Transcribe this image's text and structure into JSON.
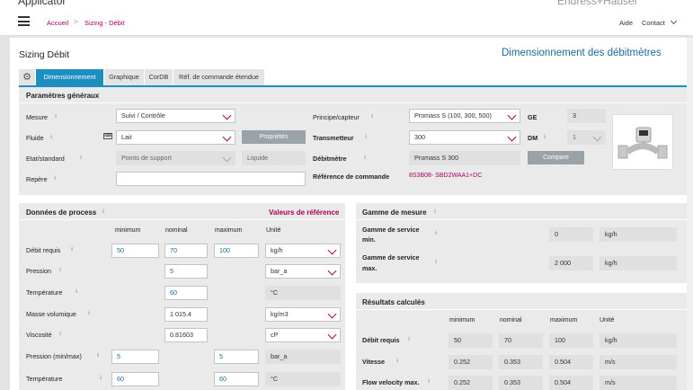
{
  "header": {
    "app_title_peek": "Applicator",
    "right_peek": "Endress+Hauser",
    "breadcrumb": {
      "home": "Accueil",
      "sep": ">",
      "current": "Sizing - Débit"
    },
    "nav": {
      "help": "Aide",
      "contact": "Contact"
    }
  },
  "page": {
    "title": "Sizing Débit",
    "subtitle": "Dimensionnement des débitmètres"
  },
  "tabs": [
    "Dimensionnement",
    "Graphique",
    "CorDB",
    "Réf. de commande étendue"
  ],
  "general": {
    "heading": "Paramètres généraux",
    "mesure_label": "Mesure",
    "mesure_value": "Suivi / Contrôle",
    "fluide_label": "Fluide",
    "fluide_value": "Lait",
    "proprietes": "Propriétés",
    "etat_label": "Etat/standard",
    "etat_value": "Points de support",
    "etat_state": "Liquide",
    "repere_label": "Repère",
    "repere_value": "",
    "principe_label": "Principe/capteur",
    "principe_value": "Promass S (100, 300, 500)",
    "ge_label": "GE",
    "ge_value": "3",
    "transmetteur_label": "Transmetteur",
    "transmetteur_value": "300",
    "dm_label": "DM",
    "dm_value": "1",
    "debitmetre_label": "Débitmètre",
    "debitmetre_value": "Promass S 300",
    "compare": "Compare",
    "refcmd_label": "Référence de commande",
    "refcmd_value": "8S3B08- SBD2WAA1+DC"
  },
  "process": {
    "heading": "Données de process",
    "ref_link": "Valeurs de référence",
    "cols": {
      "min": "minimum",
      "nom": "nominal",
      "max": "maximum",
      "unit": "Unité"
    },
    "rows": [
      {
        "label": "Débit requis",
        "min": "50",
        "nom": "70",
        "max": "100",
        "unit": "kg/h"
      },
      {
        "label": "Pression",
        "min": "",
        "nom": "5",
        "max": "",
        "unit": "bar_a"
      },
      {
        "label": "Température",
        "min": "",
        "nom": "60",
        "max": "",
        "unit": "°C"
      },
      {
        "label": "Masse volumique",
        "min": "",
        "nom": "1 015.4",
        "max": "",
        "unit": "kg/m3"
      },
      {
        "label": "Viscosité",
        "min": "",
        "nom": "0.81603",
        "max": "",
        "unit": "cP"
      },
      {
        "label": "Pression (min/max)",
        "min": "5",
        "nom": "",
        "max": "5",
        "unit": "bar_a"
      },
      {
        "label": "Température",
        "min": "60",
        "nom": "",
        "max": "60",
        "unit": "°C"
      }
    ]
  },
  "gamme": {
    "heading": "Gamme de mesure",
    "min_label_1": "Gamme de service",
    "min_label_2": "min.",
    "min_value": "0",
    "min_unit": "kg/h",
    "max_label_1": "Gamme de service",
    "max_label_2": "max.",
    "max_value": "2 000",
    "max_unit": "kg/h"
  },
  "results": {
    "heading": "Résultats calculés",
    "cols": {
      "min": "minimum",
      "nom": "nominal",
      "max": "maximum",
      "unit": "Unité"
    },
    "rows": [
      {
        "label": "Débit requis",
        "min": "50",
        "nom": "70",
        "max": "100",
        "unit": "kg/h"
      },
      {
        "label": "Vitesse",
        "min": "0.252",
        "nom": "0.353",
        "max": "0.504",
        "unit": "m/s"
      },
      {
        "label": "Flow velocity max.",
        "min": "0.252",
        "nom": "0.353",
        "max": "0.504",
        "unit": "m/s"
      }
    ]
  }
}
